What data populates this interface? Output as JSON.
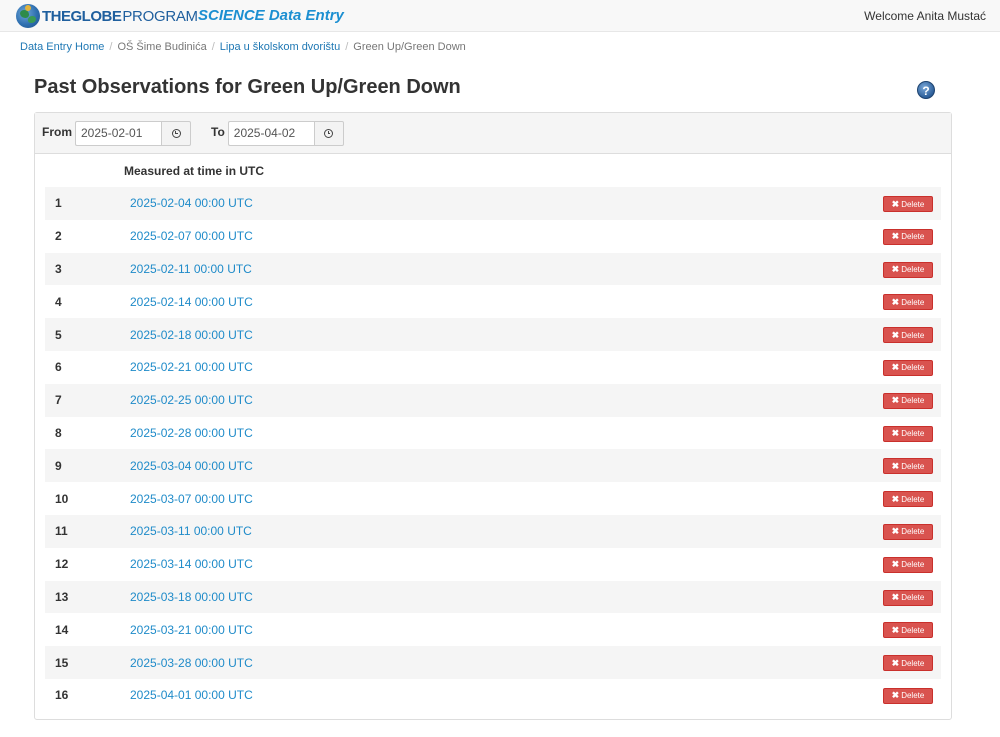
{
  "header": {
    "brand_the": "THE",
    "brand_globe": "GLOBE",
    "brand_program": "PROGRAM",
    "app_title": "SCIENCE Data Entry",
    "welcome": "Welcome Anita Mustać"
  },
  "breadcrumb": {
    "home": "Data Entry Home",
    "school": "OŠ Šime Budinića",
    "site": "Lipa u školskom dvorištu",
    "current": "Green Up/Green Down"
  },
  "page": {
    "title": "Past Observations for Green Up/Green Down",
    "help": "?"
  },
  "filter": {
    "from_label": "From",
    "from_value": "2025-02-01",
    "to_label": "To",
    "to_value": "2025-04-02"
  },
  "table": {
    "column_header": "Measured at time in UTC",
    "delete_label": "Delete",
    "delete_icon": "✖",
    "rows": [
      {
        "num": "1",
        "time": "2025-02-04 00:00 UTC"
      },
      {
        "num": "2",
        "time": "2025-02-07 00:00 UTC"
      },
      {
        "num": "3",
        "time": "2025-02-11 00:00 UTC"
      },
      {
        "num": "4",
        "time": "2025-02-14 00:00 UTC"
      },
      {
        "num": "5",
        "time": "2025-02-18 00:00 UTC"
      },
      {
        "num": "6",
        "time": "2025-02-21 00:00 UTC"
      },
      {
        "num": "7",
        "time": "2025-02-25 00:00 UTC"
      },
      {
        "num": "8",
        "time": "2025-02-28 00:00 UTC"
      },
      {
        "num": "9",
        "time": "2025-03-04 00:00 UTC"
      },
      {
        "num": "10",
        "time": "2025-03-07 00:00 UTC"
      },
      {
        "num": "11",
        "time": "2025-03-11 00:00 UTC"
      },
      {
        "num": "12",
        "time": "2025-03-14 00:00 UTC"
      },
      {
        "num": "13",
        "time": "2025-03-18 00:00 UTC"
      },
      {
        "num": "14",
        "time": "2025-03-21 00:00 UTC"
      },
      {
        "num": "15",
        "time": "2025-03-28 00:00 UTC"
      },
      {
        "num": "16",
        "time": "2025-04-01 00:00 UTC"
      }
    ]
  },
  "icons": {
    "logo": "globe-logo-icon",
    "help": "help-icon",
    "calendar": "clock-icon",
    "delete": "remove-icon"
  },
  "colors": {
    "link": "#1f8bc9",
    "danger": "#d9534f",
    "brand": "#1f5f9e"
  }
}
